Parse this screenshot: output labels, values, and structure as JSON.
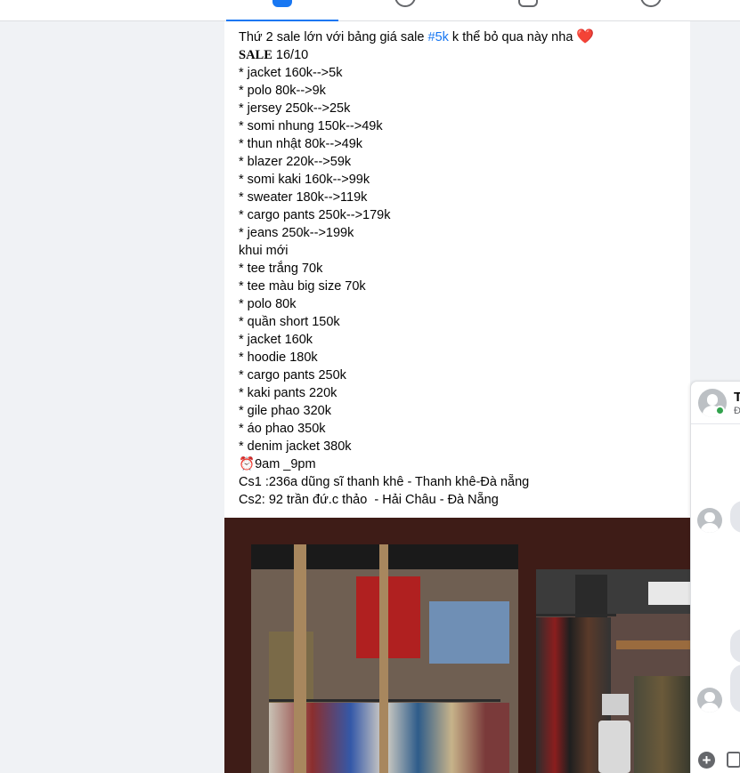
{
  "nav": {
    "tabs": [
      {
        "name": "home",
        "active": true
      },
      {
        "name": "watch",
        "active": false
      },
      {
        "name": "marketplace",
        "active": false
      },
      {
        "name": "groups",
        "active": false
      }
    ],
    "accent": "#1877f2"
  },
  "post": {
    "intro_text": "Thứ 2 sale lớn với bảng giá sale ",
    "hashtag": "#5k",
    "intro_suffix": " k thể bỏ qua này nha ",
    "heart": "❤️",
    "sale_label": "SALE",
    "sale_date": " 16/10",
    "sale_items": [
      "* jacket 160k-->5k",
      "* polo 80k-->9k",
      "* jersey 250k-->25k",
      "* somi nhung 150k-->49k",
      "* thun nhật 80k-->49k",
      "* blazer 220k-->59k",
      "* somi kaki 160k-->99k",
      "* sweater 180k-->119k",
      "* cargo pants 250k-->179k",
      "* jeans 250k-->199k"
    ],
    "new_label": "khui mới",
    "new_items": [
      "* tee trắng 70k",
      "* tee màu big size 70k",
      "* polo 80k",
      "* quần short 150k",
      "* jacket 160k",
      "* hoodie 180k",
      "* cargo pants 250k",
      "* kaki pants 220k",
      "* gile phao 320k",
      "* áo phao 350k",
      "* denim jacket 380k"
    ],
    "clock_icon": "⏰",
    "hours": "9am _9pm",
    "address1": "Cs1 :236a dũng sĩ thanh khê - Thanh khê-Đà nẵng",
    "address2": "Cs2: 92 trần đứ.c thảo  - Hải Châu - Đà Nẵng"
  },
  "chat": {
    "name": "T",
    "status": "Đ",
    "online_color": "#31a24c"
  }
}
